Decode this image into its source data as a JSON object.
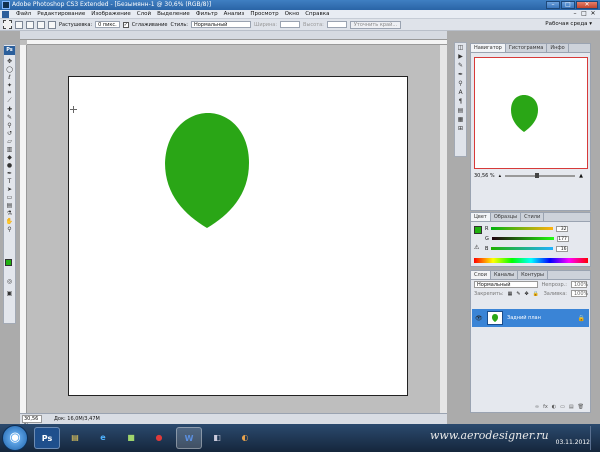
{
  "window": {
    "title": "Adobe Photoshop CS3 Extended - [Безымянн-1 @ 30,6% (RGB/8)]",
    "min": "–",
    "max": "□",
    "close": "✕"
  },
  "menu": {
    "items": [
      "Файл",
      "Редактирование",
      "Изображение",
      "Слой",
      "Выделение",
      "Фильтр",
      "Анализ",
      "Просмотр",
      "Окно",
      "Справка"
    ],
    "doc_min": "–",
    "doc_max": "□",
    "doc_close": "✕"
  },
  "options": {
    "feather_label": "Растушевка:",
    "feather_value": "0 пикс.",
    "check_mark": "✓",
    "antialias_label": "Сглаживание",
    "style_label": "Стиль:",
    "style_value": "Нормальный",
    "width_label": "Ширина:",
    "height_label": "Высота:",
    "refine_button": "Уточнить край...",
    "workspace_label": "Рабочая среда ▾"
  },
  "status": {
    "zoom": "30,56 %",
    "doc_info": "Док: 16,0M/3,47M"
  },
  "navigator": {
    "tabs": [
      "Навигатор",
      "Гистограмма",
      "Инфо"
    ],
    "zoom": "30,56 %"
  },
  "color_panel": {
    "tabs": [
      "Цвет",
      "Образцы",
      "Стили"
    ],
    "rows": [
      {
        "label": "R",
        "value": "32"
      },
      {
        "label": "G",
        "value": "177"
      },
      {
        "label": "B",
        "value": "16"
      }
    ],
    "foreground": "#20b110",
    "background": "#f1a23a"
  },
  "layers_panel": {
    "tabs": [
      "Слои",
      "Каналы",
      "Контуры"
    ],
    "blend_mode": "Нормальный",
    "opacity_label": "Непрозр.:",
    "opacity_value": "100%",
    "lock_label": "Закрепить:",
    "fill_label": "Заливка:",
    "fill_value": "100%",
    "layer_name": "Задний план",
    "footer": [
      "∞",
      "fx",
      "◐",
      "▭",
      "▤",
      "🗑"
    ]
  },
  "taskbar": {
    "start_glyph": "◉",
    "items": [
      "Ps",
      "▤",
      "e",
      "■",
      "●",
      "W",
      "◧",
      "◐"
    ],
    "watermark": "www.aerodesigner.ru",
    "date": "03.11.2012"
  },
  "colors": {
    "shape_fill": "#2aa616",
    "selection_blue": "#3a84d6"
  }
}
